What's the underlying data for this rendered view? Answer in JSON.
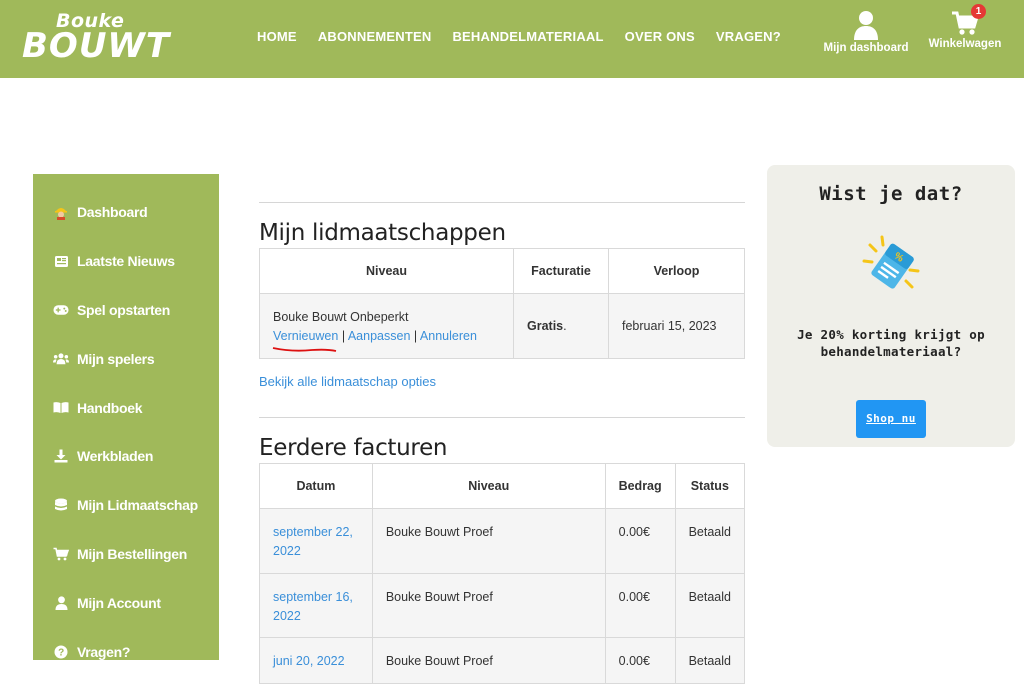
{
  "brand": {
    "line1": "Bouke",
    "line2": "BOUWT"
  },
  "nav": [
    "HOME",
    "ABONNEMENTEN",
    "BEHANDELMATERIAAL",
    "OVER ONS",
    "VRAGEN?"
  ],
  "header_actions": {
    "dashboard_label": "Mijn dashboard",
    "cart_label": "Winkelwagen",
    "cart_count": "1"
  },
  "colors": {
    "brand_green": "#a0b95a",
    "link_blue": "#3a8fd9",
    "button_blue": "#2196f3",
    "badge_red": "#e53935"
  },
  "sidebar": {
    "items": [
      {
        "label": "Dashboard",
        "icon": "worker-icon"
      },
      {
        "label": "Laatste Nieuws",
        "icon": "newspaper-icon"
      },
      {
        "label": "Spel opstarten",
        "icon": "gamepad-icon"
      },
      {
        "label": "Mijn spelers",
        "icon": "users-icon"
      },
      {
        "label": "Handboek",
        "icon": "book-open-icon"
      },
      {
        "label": "Werkbladen",
        "icon": "download-icon"
      },
      {
        "label": "Mijn Lidmaatschap",
        "icon": "database-icon"
      },
      {
        "label": "Mijn Bestellingen",
        "icon": "cart-icon"
      },
      {
        "label": "Mijn Account",
        "icon": "user-icon"
      },
      {
        "label": "Vragen?",
        "icon": "question-circle-icon"
      }
    ]
  },
  "memberships": {
    "title": "Mijn lidmaatschappen",
    "headers": [
      "Niveau",
      "Facturatie",
      "Verloop"
    ],
    "row": {
      "level": "Bouke Bouwt Onbeperkt",
      "actions": [
        "Vernieuwen",
        "Aanpassen",
        "Annuleren"
      ],
      "separator": "|",
      "billing": "Gratis",
      "billing_suffix": ".",
      "expiry": "februari 15, 2023"
    },
    "all_options_link": "Bekijk alle lidmaatschap opties"
  },
  "invoices": {
    "title": "Eerdere facturen",
    "headers": [
      "Datum",
      "Niveau",
      "Bedrag",
      "Status"
    ],
    "rows": [
      {
        "date": "september 22, 2022",
        "level": "Bouke Bouwt Proef",
        "amount": "0.00€",
        "status": "Betaald"
      },
      {
        "date": "september 16, 2022",
        "level": "Bouke Bouwt Proef",
        "amount": "0.00€",
        "status": "Betaald"
      },
      {
        "date": "juni 20, 2022",
        "level": "Bouke Bouwt Proef",
        "amount": "0.00€",
        "status": "Betaald"
      }
    ]
  },
  "widget": {
    "title": "Wist je dat?",
    "text": "Je 20% korting krijgt op behandelmateriaal?",
    "button": "Shop nu",
    "icon": "discount-tag-icon"
  }
}
